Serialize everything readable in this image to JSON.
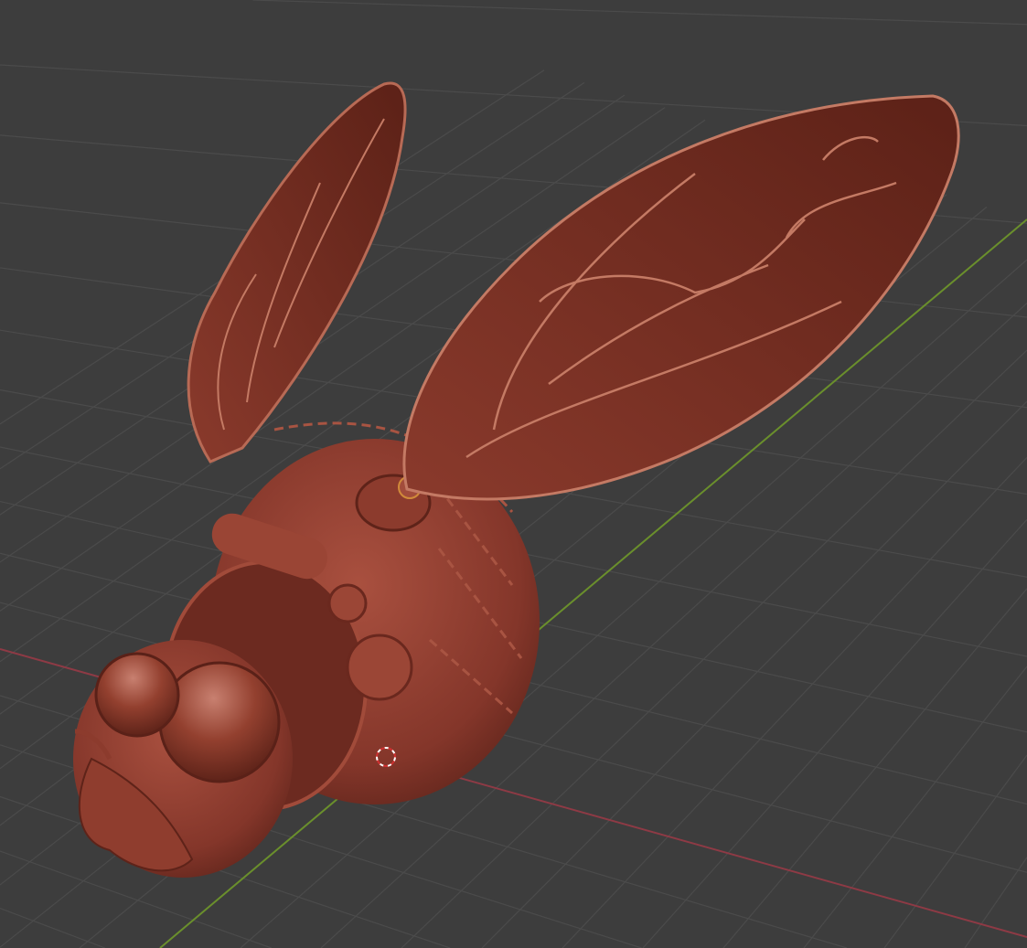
{
  "viewport": {
    "background": "#3d3d3d",
    "grid_color": "#4b4b4b",
    "x_axis_color": "#8e3a45",
    "y_axis_color": "#6a8f2c"
  },
  "model": {
    "body_color": "#8c3b2d",
    "wing_color": "#6e2a1f",
    "vein_color": "#c47a64"
  },
  "cursor": {
    "icon": "3d-cursor-icon"
  }
}
